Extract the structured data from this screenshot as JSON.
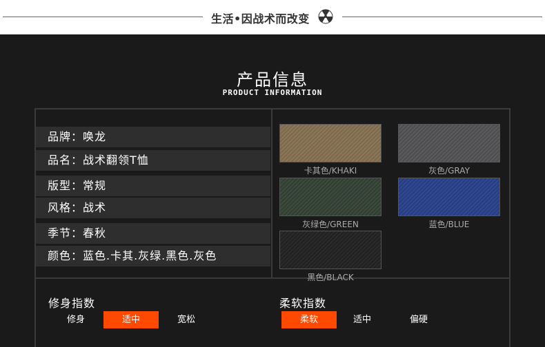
{
  "header": {
    "slogan": "生活•因战术而改变",
    "logo_icon": "radiation-icon"
  },
  "product": {
    "title_cn": "产品信息",
    "title_en": "PRODUCT INFORMATION",
    "rows": [
      "品牌：唤龙",
      "品名：战术翻领T恤",
      "版型：常规",
      "风格：战术",
      "季节：春秋",
      "颜色：蓝色.卡其.灰绿.黑色.灰色"
    ]
  },
  "colors": [
    {
      "label": "卡其色/KHAKI",
      "hex": "#8b7557"
    },
    {
      "label": "灰色/GRAY",
      "hex": "#5a5a5c"
    },
    {
      "label": "灰绿色/GREEN",
      "hex": "#3b4a3c"
    },
    {
      "label": "蓝色/BLUE",
      "hex": "#2f468e"
    },
    {
      "label": "黑色/BLACK",
      "hex": "#2a2a2a"
    }
  ],
  "fit_index": {
    "title": "修身指数",
    "options": [
      "修身",
      "适中",
      "宽松"
    ],
    "selected": 1
  },
  "soft_index": {
    "title": "柔软指数",
    "options": [
      "柔软",
      "适中",
      "偏硬"
    ],
    "selected": 0
  },
  "accent_color": "#ff4800"
}
